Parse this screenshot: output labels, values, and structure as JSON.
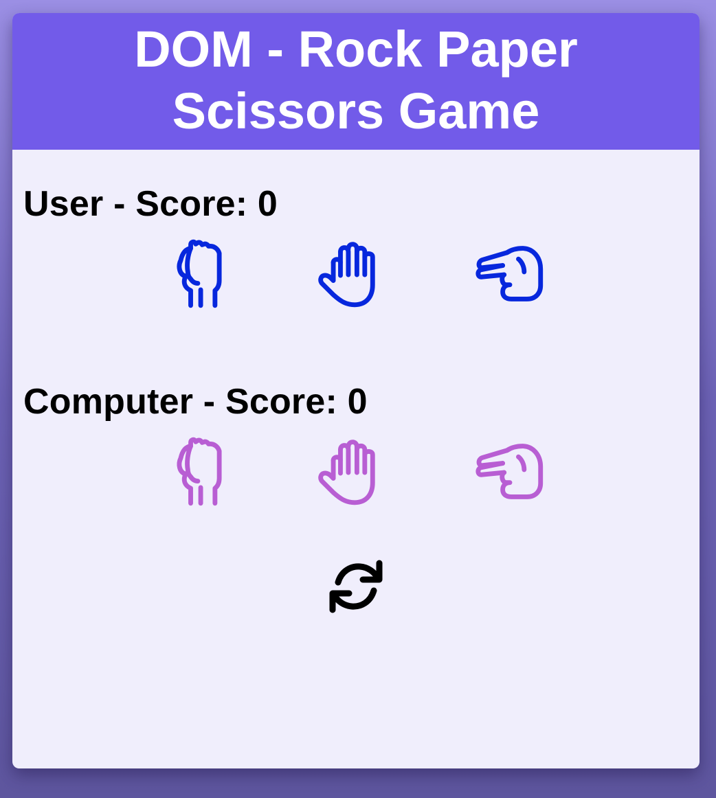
{
  "header": {
    "title": "DOM - Rock Paper Scissors Game"
  },
  "user": {
    "label": "User - Score: 0",
    "color": "#0727dd",
    "choices": [
      {
        "name": "rock",
        "icon": "hand-rock-icon"
      },
      {
        "name": "paper",
        "icon": "hand-paper-icon"
      },
      {
        "name": "scissors",
        "icon": "hand-scissors-icon"
      }
    ]
  },
  "computer": {
    "label": "Computer - Score: 0",
    "color": "#b85ed3",
    "choices": [
      {
        "name": "rock",
        "icon": "hand-rock-icon"
      },
      {
        "name": "paper",
        "icon": "hand-paper-icon"
      },
      {
        "name": "scissors",
        "icon": "hand-scissors-icon"
      }
    ]
  },
  "reset": {
    "icon": "refresh-icon"
  },
  "colors": {
    "header_bg": "#725be9",
    "card_bg": "#f0eefc"
  }
}
